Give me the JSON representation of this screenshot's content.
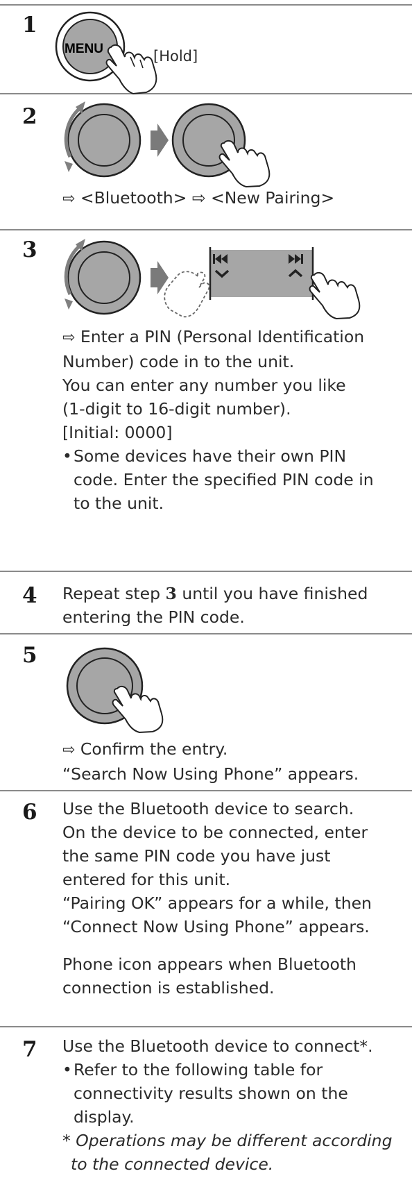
{
  "steps": {
    "s1": {
      "num": "1",
      "menu_label": "MENU",
      "hold_label": "[Hold]"
    },
    "s2": {
      "num": "2",
      "arrow": "⇨",
      "path": "<Bluetooth> ⇨ <New Pairing>"
    },
    "s3": {
      "num": "3",
      "arrow": "⇨",
      "l1": "Enter a PIN (Personal Identification",
      "l2": "Number) code in to the unit.",
      "l3": "You can enter any number you like",
      "l4": "(1-digit to 16-digit number).",
      "l5": "[Initial: 0000]",
      "b1": "Some devices have their own PIN",
      "b2": "code. Enter the specified PIN code in",
      "b3": "to the unit."
    },
    "s4": {
      "num": "4",
      "l1_pre": "Repeat step ",
      "l1_bold": "3",
      "l1_post": " until you have finished",
      "l2": "entering the PIN code."
    },
    "s5": {
      "num": "5",
      "arrow": "⇨",
      "l1": "Confirm the entry.",
      "l2": "“Search Now Using Phone” appears."
    },
    "s6": {
      "num": "6",
      "l1": "Use the Bluetooth device to search.",
      "l2": "On the device to be connected, enter",
      "l3": "the same PIN code you have just",
      "l4": "entered for this unit.",
      "l5": "“Pairing OK” appears for a while, then",
      "l6": "“Connect Now Using Phone” appears.",
      "p1": "Phone icon appears when Bluetooth",
      "p2": "connection is established."
    },
    "s7": {
      "num": "7",
      "l1": "Use the Bluetooth device to connect*.",
      "b1": "Refer to the following table for",
      "b2": "connectivity results shown on the",
      "b3": "display.",
      "f1": "* Operations may be different according",
      "f2": "to the connected device."
    }
  },
  "bullet": "•"
}
